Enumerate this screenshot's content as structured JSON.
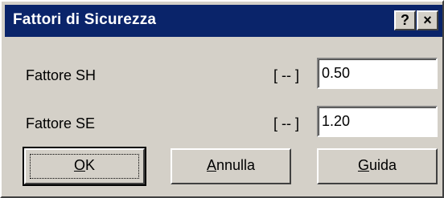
{
  "window": {
    "title": "Fattori di Sicurezza",
    "help_button": "?",
    "close_button": "×"
  },
  "fields": [
    {
      "label": "Fattore SH",
      "unit": "[ -- ]",
      "value": "0.50"
    },
    {
      "label": "Fattore SE",
      "unit": "[ -- ]",
      "value": "1.20"
    }
  ],
  "buttons": {
    "ok": {
      "mnemonic": "O",
      "rest": "K"
    },
    "cancel": {
      "mnemonic": "A",
      "rest": "nnulla"
    },
    "help": {
      "mnemonic": "G",
      "rest": "uida"
    }
  },
  "colors": {
    "titlebar": "#0a246a",
    "face": "#d4d0c8"
  }
}
